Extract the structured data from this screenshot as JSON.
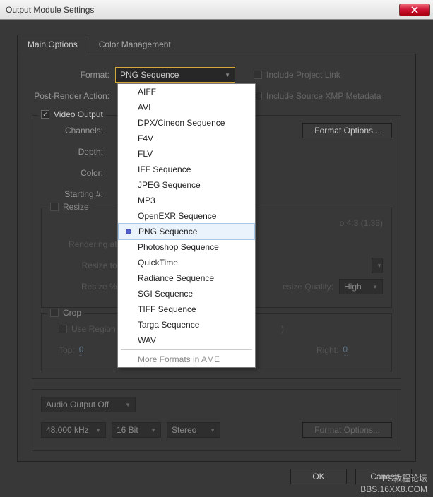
{
  "window": {
    "title": "Output Module Settings"
  },
  "tabs": {
    "main": "Main Options",
    "color": "Color Management"
  },
  "format": {
    "label": "Format:",
    "value": "PNG Sequence",
    "options": [
      "AIFF",
      "AVI",
      "DPX/Cineon Sequence",
      "F4V",
      "FLV",
      "IFF Sequence",
      "JPEG Sequence",
      "MP3",
      "OpenEXR Sequence",
      "PNG Sequence",
      "Photoshop Sequence",
      "QuickTime",
      "Radiance Sequence",
      "SGI Sequence",
      "TIFF Sequence",
      "Targa Sequence",
      "WAV"
    ],
    "more": "More Formats in AME",
    "include_link": "Include Project Link",
    "include_xmp": "Include Source XMP Metadata"
  },
  "post_render": {
    "label": "Post-Render Action:"
  },
  "video_output": {
    "legend": "Video Output",
    "channels_label": "Channels:",
    "depth_label": "Depth:",
    "color_label": "Color:",
    "starting_label": "Starting #:",
    "format_options": "Format Options..."
  },
  "resize": {
    "legend": "Resize",
    "lock_aspect": "o 4:3 (1.33)",
    "rendering_at": "Rendering at:",
    "resize_to": "Resize to:",
    "resize_pct": "Resize %:",
    "quality_label": "esize Quality:",
    "quality_value": "High"
  },
  "crop": {
    "legend": "Crop",
    "use_region": "Use Region",
    "top_label": "Top:",
    "top_value": "0",
    "right_label": "Right:",
    "right_value": "0",
    "bracket": ")"
  },
  "audio": {
    "label": "Audio Output Off",
    "rate": "48.000 kHz",
    "depth": "16 Bit",
    "channels": "Stereo",
    "format_options": "Format Options..."
  },
  "footer": {
    "ok": "OK",
    "cancel": "Cancel"
  },
  "watermark": {
    "line1": "PS教程论坛",
    "line2": "BBS.16XX8.COM"
  }
}
